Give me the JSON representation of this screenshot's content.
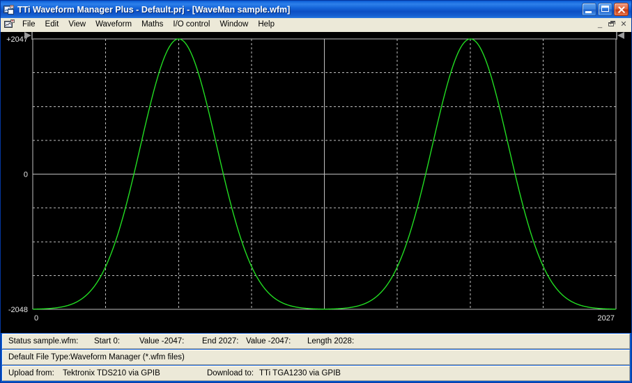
{
  "window": {
    "title": "TTi Waveform Manager Plus - Default.prj - [WaveMan sample.wfm]",
    "app_icon": "waveform-app-icon",
    "controls": {
      "minimize": "minimize-button",
      "maximize": "maximize-button",
      "close": "close-button"
    },
    "accent_title_color": "#1464d8",
    "client_background": "#000000"
  },
  "menu": {
    "mdi_icon": "mdi-document-icon",
    "items": [
      {
        "label": "File"
      },
      {
        "label": "Edit"
      },
      {
        "label": "View"
      },
      {
        "label": "Waveform"
      },
      {
        "label": "Maths"
      },
      {
        "label": "I/O control"
      },
      {
        "label": "Window"
      },
      {
        "label": "Help"
      }
    ],
    "mdi_controls": {
      "minimize": "_",
      "restore": "restore-icon",
      "close": "✕"
    }
  },
  "status_line_1": {
    "status_label": "Status sample.wfm:",
    "start_label": "Start 0:",
    "start_value_label": "Value -2047:",
    "end_label": "End 2027:",
    "end_value_label": "Value -2047:",
    "length_label": "Length 2028:"
  },
  "status_line_2": {
    "label": "Default File Type:",
    "value": "Waveform Manager (*.wfm files)"
  },
  "status_line_3": {
    "upload_label": "Upload from:",
    "upload_value": "Tektronix TDS210 via GPIB",
    "download_label": "Download to:",
    "download_value": "TTi TGA1230 via GPIB"
  },
  "chart_data": {
    "type": "line",
    "title": "WaveMan sample.wfm",
    "xlabel": "",
    "ylabel": "",
    "trace_color": "#22dd22",
    "background": "#000000",
    "grid": true,
    "grid_color": "#c0c0c0",
    "axis_color": "#c0c0c0",
    "legend": "none",
    "xlim": [
      0,
      2027
    ],
    "ylim": [
      -2048,
      2047
    ],
    "y_ticks": [
      2047,
      0,
      -2048
    ],
    "y_tick_labels": [
      "+2047",
      "0",
      "-2048"
    ],
    "x_ticks": [
      0,
      2027
    ],
    "x_tick_labels": [
      "0",
      "2027"
    ],
    "x_grid_divisions": 8,
    "y_grid_divisions": 8,
    "markers": {
      "left_marker": "play-right-marker",
      "right_marker": "play-left-marker"
    },
    "waveform": {
      "description": "Two gaussian pulse cycles from -2048 baseline to +2047 peak",
      "points": 2028,
      "cycles": 2,
      "baseline": -2048,
      "peak": 2047,
      "peak_x": [
        507,
        1521
      ],
      "sigma_x": 132,
      "sample_start": 0,
      "sample_start_value": -2047,
      "sample_end": 2027,
      "sample_end_value": -2047,
      "length": 2028
    }
  }
}
